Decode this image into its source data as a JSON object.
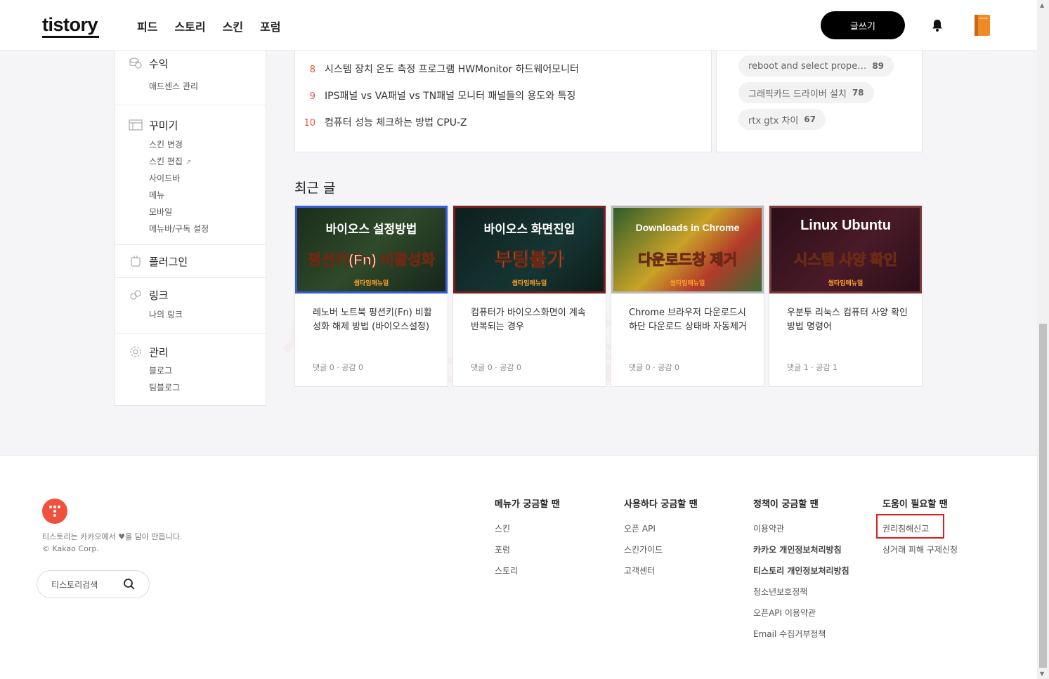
{
  "header": {
    "logo": "tistory",
    "nav": [
      "피드",
      "스토리",
      "스킨",
      "포럼"
    ],
    "write_label": "글쓰기",
    "icons": [
      "bell-icon",
      "profile-avatar"
    ]
  },
  "sidebar": {
    "groups": [
      {
        "title": "수익",
        "icon": "coins-icon",
        "items": [
          "애드센스 관리"
        ]
      },
      {
        "title": "꾸미기",
        "icon": "layout-icon",
        "items": [
          "스킨 변경",
          "스킨 편집",
          "사이드바",
          "메뉴",
          "모바일",
          "메뉴바/구독 설정"
        ]
      },
      {
        "title": "플러그인",
        "icon": "plugin-icon",
        "items": []
      },
      {
        "title": "링크",
        "icon": "link-icon",
        "items": [
          "나의 링크"
        ]
      },
      {
        "title": "관리",
        "icon": "gear-icon",
        "items": [
          "블로그",
          "팀블로그"
        ]
      }
    ]
  },
  "popular_posts": [
    {
      "rank": "8",
      "title": "시스템 장치 온도 측정 프로그램 HWMonitor 하드웨어모니터"
    },
    {
      "rank": "9",
      "title": "IPS패널 vs VA패널 vs TN패널 모니터 패널들의 용도와 특징"
    },
    {
      "rank": "10",
      "title": "컴퓨터 성능 체크하는 방법 CPU-Z"
    }
  ],
  "keywords": [
    {
      "text": "reboot and select prope…",
      "count": "89"
    },
    {
      "text": "그래픽카드 드라이버 설치",
      "count": "78"
    },
    {
      "text": "rtx gtx 차이",
      "count": "67"
    }
  ],
  "recent": {
    "title": "최근 글",
    "posts": [
      {
        "thumb_l1": "바이오스 설정방법",
        "thumb_l2": "펑션키(Fn) 비활성화",
        "thumb_l3": "썸타임매뉴얼",
        "title": "레노버 노트북 펑션키(Fn) 비활성화 해제 방법 (바이오스설정)",
        "meta": "댓글 0 · 공감 0",
        "colors": {
          "bg": "#1f3a1f",
          "border": "#3a5bd6"
        }
      },
      {
        "thumb_l1": "바이오스 화면진입",
        "thumb_l2": "부팅불가",
        "thumb_l3": "썸타임매뉴얼",
        "title": "컴퓨터가 바이오스화면이 계속 반복되는 경우",
        "meta": "댓글 0 · 공감 0",
        "colors": {
          "bg": "#0f2a28",
          "border": "#7a1f1f"
        }
      },
      {
        "thumb_l1": "Downloads in Chrome",
        "thumb_l2": "다운로드창 제거",
        "thumb_l3": "썸타임매뉴얼",
        "title": "Chrome 브라우저 다운로드시 하단 다운로드 상태바 자동제거",
        "meta": "댓글 0 · 공감 0",
        "colors": {
          "bg": "#3a6b34",
          "border": "#b9b9b9"
        }
      },
      {
        "thumb_l1": "Linux Ubuntu",
        "thumb_l2": "시스템 사양 확인",
        "thumb_l3": "썸타임매뉴얼",
        "title": "우분투 리눅스 컴퓨터 사양 확인 방법 명령어",
        "meta": "댓글 1 · 공감 1",
        "colors": {
          "bg": "#3a1420",
          "border": "#7a3a3a"
        }
      }
    ]
  },
  "footer": {
    "about": "티스토리는 카카오에서 ♥을 담아 만듭니다.",
    "copyright": "© Kakao Corp.",
    "search_placeholder": "티스토리검색",
    "columns": [
      {
        "title": "메뉴가 궁금할 땐",
        "links": [
          "스킨",
          "포럼",
          "스토리"
        ]
      },
      {
        "title": "사용하다 궁금할 땐",
        "links": [
          "오픈 API",
          "스킨가이드",
          "고객센터"
        ]
      },
      {
        "title": "정책이 궁금할 땐",
        "links": [
          "이용약관",
          "카카오 개인정보처리방침",
          "티스토리 개인정보처리방침",
          "청소년보호정책",
          "오픈API 이용약관",
          "Email 수집거부정책"
        ]
      },
      {
        "title": "도움이 필요할 땐",
        "links": [
          "권리침해신고",
          "상거래 피해 구제신청"
        ]
      }
    ]
  },
  "colors": {
    "accent": "#f0513d",
    "highlight": "#e01b1b"
  }
}
